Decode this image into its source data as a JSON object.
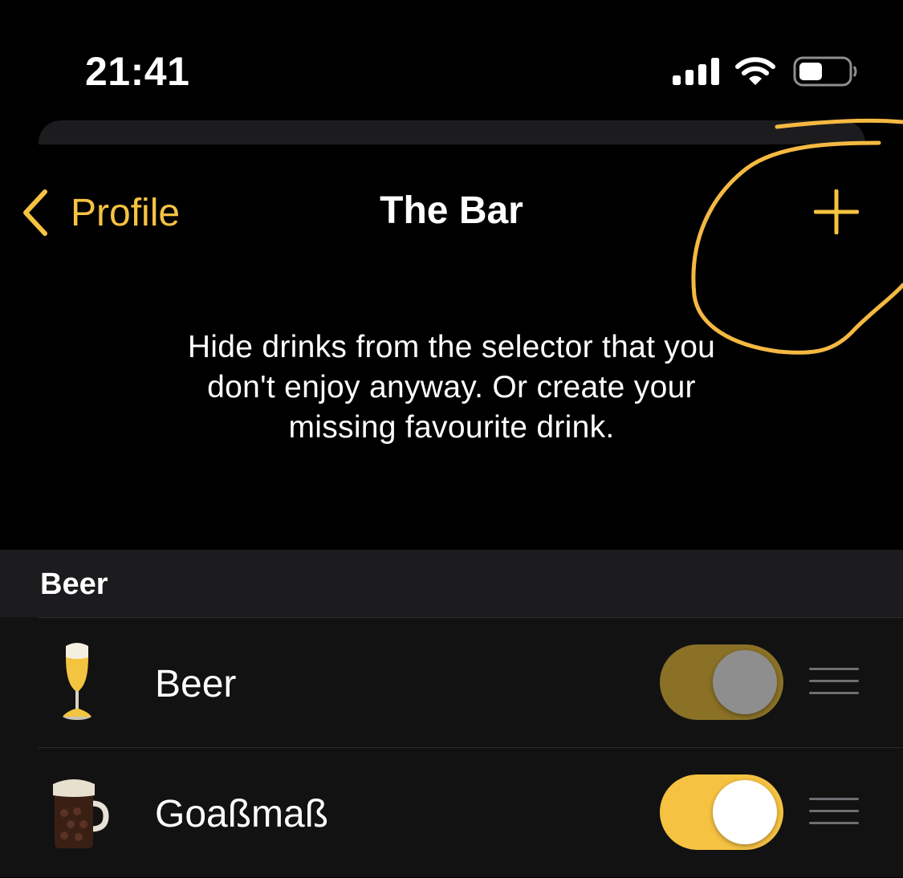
{
  "status_bar": {
    "time": "21:41",
    "icons": [
      "cellular-signal-icon",
      "wifi-icon",
      "battery-icon"
    ]
  },
  "nav": {
    "back_label": "Profile",
    "title": "The Bar",
    "add_icon": "plus-icon"
  },
  "description": "Hide drinks from the selector that you don't enjoy anyway. Or create your missing favourite drink.",
  "sections": [
    {
      "header": "Beer",
      "items": [
        {
          "label": "Beer",
          "icon": "beer-glass-icon",
          "enabled": true,
          "dimmed": true
        },
        {
          "label": "Goaßmaß",
          "icon": "beer-mug-icon",
          "enabled": true,
          "dimmed": false
        }
      ]
    }
  ],
  "colors": {
    "accent": "#f5c242",
    "accent_dimmed": "#8a7126",
    "background": "#000000",
    "row_background": "#121212",
    "section_background": "#1c1c1e",
    "annotation": "#f5b942"
  }
}
